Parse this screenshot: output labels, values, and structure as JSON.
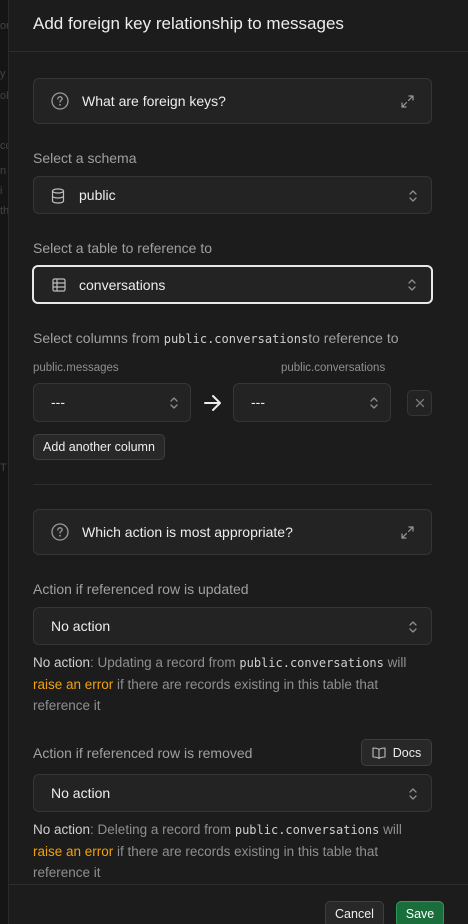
{
  "panel": {
    "title": "Add foreign key relationship to messages"
  },
  "help_foreign_keys": {
    "label": "What are foreign keys?"
  },
  "schema": {
    "label": "Select a schema",
    "value": "public"
  },
  "table_ref": {
    "label": "Select a table to reference to",
    "value": "conversations"
  },
  "columns": {
    "label_prefix": "Select columns from ",
    "label_code": "public.conversations",
    "label_suffix": "to reference to",
    "left_header": "public.messages",
    "right_header": "public.conversations",
    "left_value": "---",
    "right_value": "---",
    "add_label": "Add another column"
  },
  "help_action": {
    "label": "Which action is most appropriate?"
  },
  "on_update": {
    "label": "Action if referenced row is updated",
    "value": "No action",
    "desc_strong": "No action",
    "desc_1": ": Updating a record from ",
    "desc_code": "public.conversations",
    "desc_2": " will",
    "desc_warn": "raise an error",
    "desc_3": " if there are records existing in this table that",
    "desc_4": "reference it"
  },
  "on_delete": {
    "label": "Action if referenced row is removed",
    "docs_label": "Docs",
    "value": "No action",
    "desc_strong": "No action",
    "desc_1": ": Deleting a record from ",
    "desc_code": "public.conversations",
    "desc_2": " will",
    "desc_warn": "raise an error",
    "desc_3": " if there are records existing in this table that",
    "desc_4": "reference it"
  },
  "footer": {
    "cancel_label": "Cancel",
    "save_label": "Save"
  },
  "backdrop": {
    "fragments": [
      "ou",
      "y",
      "ol",
      "co",
      "n",
      "i",
      "re",
      "th",
      "T"
    ]
  },
  "icons": {
    "help": "question-circle-icon",
    "expand": "expand-arrows-icon",
    "database": "database-icon",
    "table": "table-grid-icon",
    "chevrons": "chevron-up-down-icon",
    "arrow": "arrow-right-icon",
    "remove": "close-icon",
    "book": "book-open-icon"
  },
  "colors": {
    "warning": "#f1a10d",
    "save": "#1a6e3c",
    "focus_border": "#e8e8e8"
  }
}
